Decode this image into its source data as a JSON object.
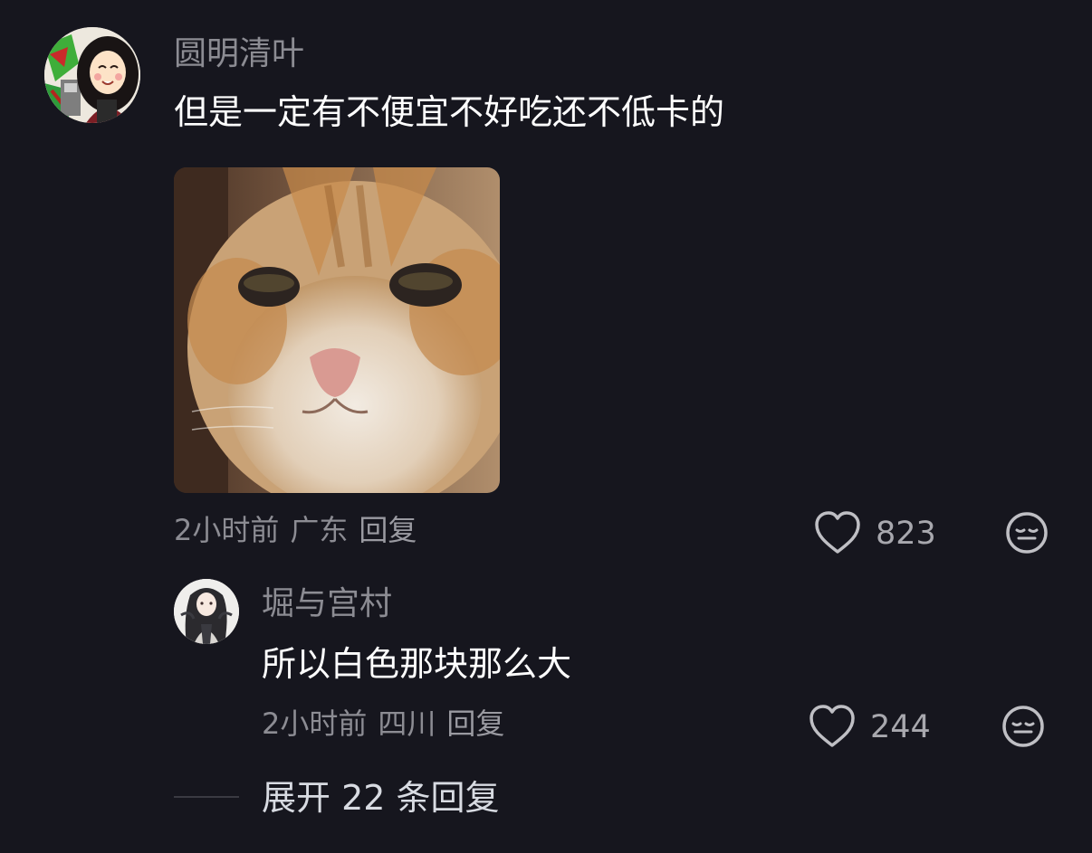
{
  "comment": {
    "username": "圆明清叶",
    "text": "但是一定有不便宜不好吃还不低卡的",
    "time": "2小时前",
    "location": "广东",
    "reply_label": "回复",
    "likes": "823"
  },
  "reply": {
    "username": "堀与宫村",
    "text": "所以白色那块那么大",
    "time": "2小时前",
    "location": "四川",
    "reply_label": "回复",
    "likes": "244"
  },
  "expand": {
    "label": "展开 22 条回复"
  },
  "colors": {
    "background": "#16161e",
    "username": "#8c8c93",
    "text": "#ffffff",
    "meta": "#8c8c93"
  },
  "icons": {
    "like": "heart-outline-icon",
    "dislike": "meh-face-icon"
  }
}
